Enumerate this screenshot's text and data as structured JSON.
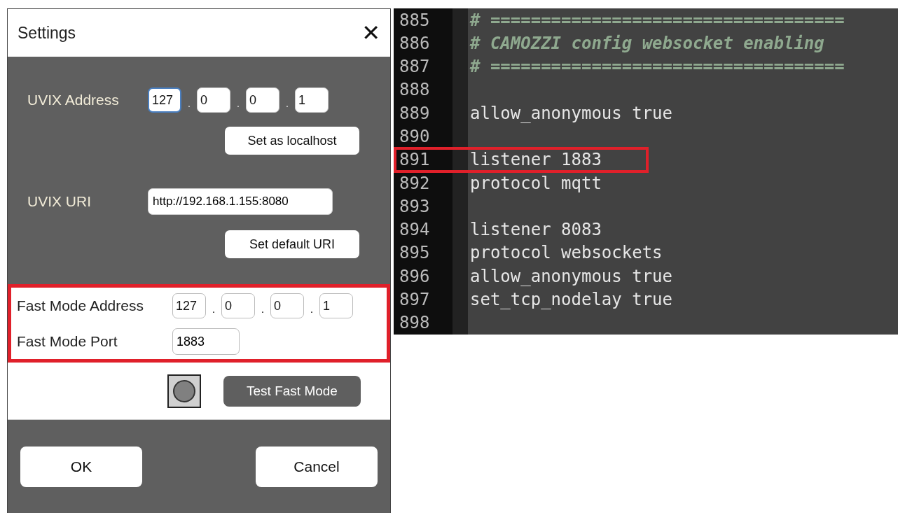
{
  "dialog": {
    "title": "Settings",
    "close": "✕",
    "uvix_address": {
      "label": "UVIX Address",
      "octets": [
        {
          "value": "127",
          "focused": true
        },
        {
          "value": "0",
          "focused": false
        },
        {
          "value": "0",
          "focused": false
        },
        {
          "value": "1",
          "focused": false
        }
      ],
      "separator": ".",
      "button": "Set as localhost"
    },
    "uvix_uri": {
      "label": "UVIX URI",
      "value": "http://192.168.1.155:8080",
      "button": "Set default URI"
    },
    "fast_mode": {
      "highlighted": true,
      "address_label": "Fast Mode Address",
      "octets": [
        {
          "value": "127",
          "focused": false
        },
        {
          "value": "0",
          "focused": false
        },
        {
          "value": "0",
          "focused": false
        },
        {
          "value": "1",
          "focused": false
        }
      ],
      "separator": ".",
      "port_label": "Fast Mode Port",
      "port": "1883"
    },
    "test_button": "Test Fast Mode",
    "buttons": [
      "OK",
      "Cancel"
    ]
  },
  "editor": {
    "lines": [
      {
        "number": "885",
        "text": "# ===================================",
        "kind": "comment",
        "highlighted": false
      },
      {
        "number": "886",
        "text": "# CAMOZZI config websocket enabling",
        "kind": "comment",
        "highlighted": false
      },
      {
        "number": "887",
        "text": "# ===================================",
        "kind": "comment",
        "highlighted": false
      },
      {
        "number": "888",
        "kind": "blank",
        "highlighted": false
      },
      {
        "number": "889",
        "text": "allow_anonymous true",
        "kind": "code",
        "highlighted": false
      },
      {
        "number": "890",
        "kind": "blank",
        "highlighted": false
      },
      {
        "number": "891",
        "text": "listener 1883",
        "kind": "code",
        "highlighted": true
      },
      {
        "number": "892",
        "text": "protocol mqtt",
        "kind": "code",
        "highlighted": false
      },
      {
        "number": "893",
        "kind": "blank",
        "highlighted": false
      },
      {
        "number": "894",
        "text": "listener 8083",
        "kind": "code",
        "highlighted": false
      },
      {
        "number": "895",
        "text": "protocol websockets",
        "kind": "code",
        "highlighted": false
      },
      {
        "number": "896",
        "text": "allow_anonymous true",
        "kind": "code",
        "highlighted": false
      },
      {
        "number": "897",
        "text": "set_tcp_nodelay true",
        "kind": "code",
        "highlighted": false
      },
      {
        "number": "898",
        "kind": "blank",
        "highlighted": false
      }
    ]
  }
}
